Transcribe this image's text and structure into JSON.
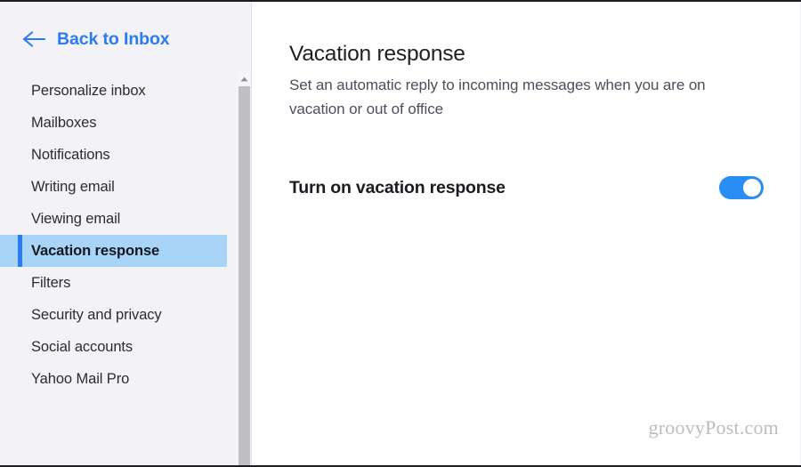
{
  "sidebar": {
    "back": {
      "label": "Back to Inbox",
      "icon": "arrow-left-icon",
      "color": "#2a7cf0"
    },
    "items": [
      {
        "label": "Personalize inbox",
        "selected": false
      },
      {
        "label": "Mailboxes",
        "selected": false
      },
      {
        "label": "Notifications",
        "selected": false
      },
      {
        "label": "Writing email",
        "selected": false
      },
      {
        "label": "Viewing email",
        "selected": false
      },
      {
        "label": "Vacation response",
        "selected": true
      },
      {
        "label": "Filters",
        "selected": false
      },
      {
        "label": "Security and privacy",
        "selected": false
      },
      {
        "label": "Social accounts",
        "selected": false
      },
      {
        "label": "Yahoo Mail Pro",
        "selected": false
      }
    ],
    "selected_bg": "#a8d4f7",
    "selected_accent": "#2a7cf0",
    "background": "#f3f2f7",
    "scrollbar": {
      "up_icon": "caret-up-icon",
      "down_icon": "caret-down-icon",
      "thumb_color": "#bfbfc2"
    }
  },
  "main": {
    "title": "Vacation response",
    "subtitle": "Set an automatic reply to incoming messages when you are on vacation or out of office",
    "setting": {
      "label": "Turn on vacation response",
      "toggle_state": "on",
      "toggle_on_color": "#2a8cf5"
    }
  },
  "watermark": {
    "text": "groovyPost.com"
  }
}
